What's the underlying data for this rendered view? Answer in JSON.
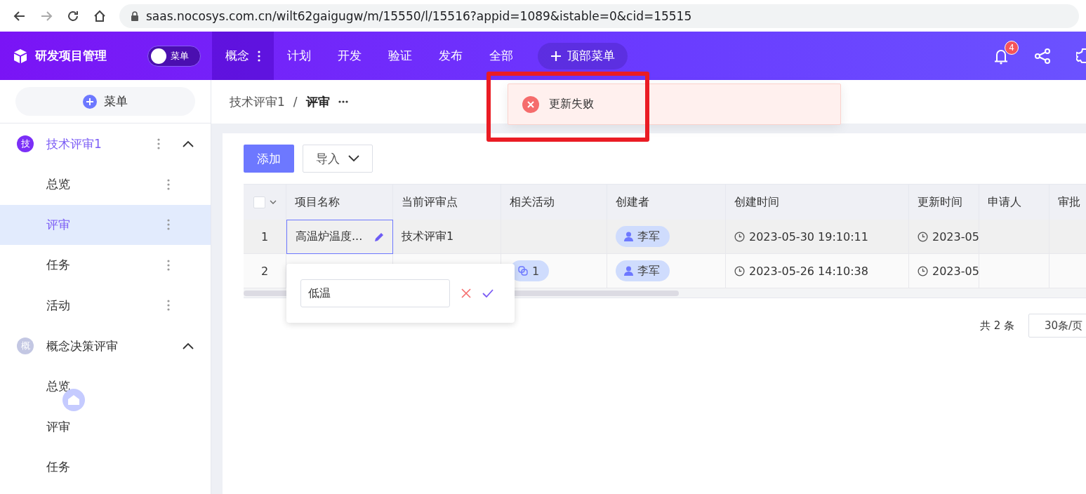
{
  "browser": {
    "url": "saas.nocosys.com.cn/wilt62gaigugw/m/15550/l/15516?appid=1089&istable=0&cid=15515"
  },
  "app": {
    "title": "研发项目管理",
    "menu_toggle": "菜单",
    "top_menu_button": "顶部菜单",
    "notification_count": "4",
    "nav": [
      {
        "label": "概念",
        "selected": true
      },
      {
        "label": "计划",
        "selected": false
      },
      {
        "label": "开发",
        "selected": false
      },
      {
        "label": "验证",
        "selected": false
      },
      {
        "label": "发布",
        "selected": false
      },
      {
        "label": "全部",
        "selected": false
      }
    ]
  },
  "sidebar": {
    "add_menu": "菜单",
    "groups": [
      {
        "avatar": "技",
        "color": "#7b2ff7",
        "title": "技术评审1",
        "active": true,
        "expanded": true,
        "items": [
          {
            "label": "总览",
            "selected": false
          },
          {
            "label": "评审",
            "selected": true
          },
          {
            "label": "任务",
            "selected": false
          },
          {
            "label": "活动",
            "selected": false
          }
        ]
      },
      {
        "avatar": "概",
        "color": "#c3c7e3",
        "title": "概念决策评审",
        "active": false,
        "expanded": true,
        "items": [
          {
            "label": "总览",
            "selected": false
          },
          {
            "label": "评审",
            "selected": false
          },
          {
            "label": "任务",
            "selected": false
          }
        ]
      }
    ]
  },
  "breadcrumb": {
    "parent": "技术评审1",
    "separator": "/",
    "current": "评审"
  },
  "toolbar": {
    "add": "添加",
    "import": "导入"
  },
  "table": {
    "all_selected": false,
    "columns": [
      "项目名称",
      "当前评审点",
      "相关活动",
      "创建者",
      "创建时间",
      "更新时间",
      "申请人",
      "审批"
    ],
    "rows": [
      {
        "index": "1",
        "name": "高温炉温度...",
        "review_point": "技术评审1",
        "activity": "",
        "creator": "李军",
        "created": "2023-05-30 19:10:11",
        "updated": "2023-05"
      },
      {
        "index": "2",
        "name": "",
        "review_point": "",
        "activity": "1",
        "creator": "李军",
        "created": "2023-05-26 14:10:38",
        "updated": "2023-05"
      }
    ]
  },
  "editor": {
    "value": "低温"
  },
  "toast": {
    "message": "更新失败"
  },
  "pagination": {
    "total": "共 2 条",
    "page_size": "30条/页"
  }
}
